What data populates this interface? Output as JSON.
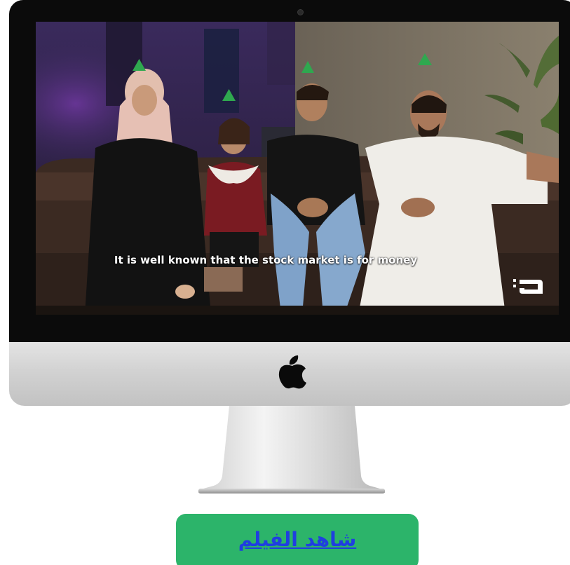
{
  "video": {
    "subtitle": "It is well known that the stock market is for money",
    "channel_logo_icon": "channel-logo-icon",
    "marker_icon": "green-triangle-marker-icon"
  },
  "monitor": {
    "brand_icon": "apple-logo-icon"
  },
  "cta": {
    "label": "شاهد الفيلم",
    "background_color": "#2cb46a",
    "text_color": "#1f3fe0"
  }
}
